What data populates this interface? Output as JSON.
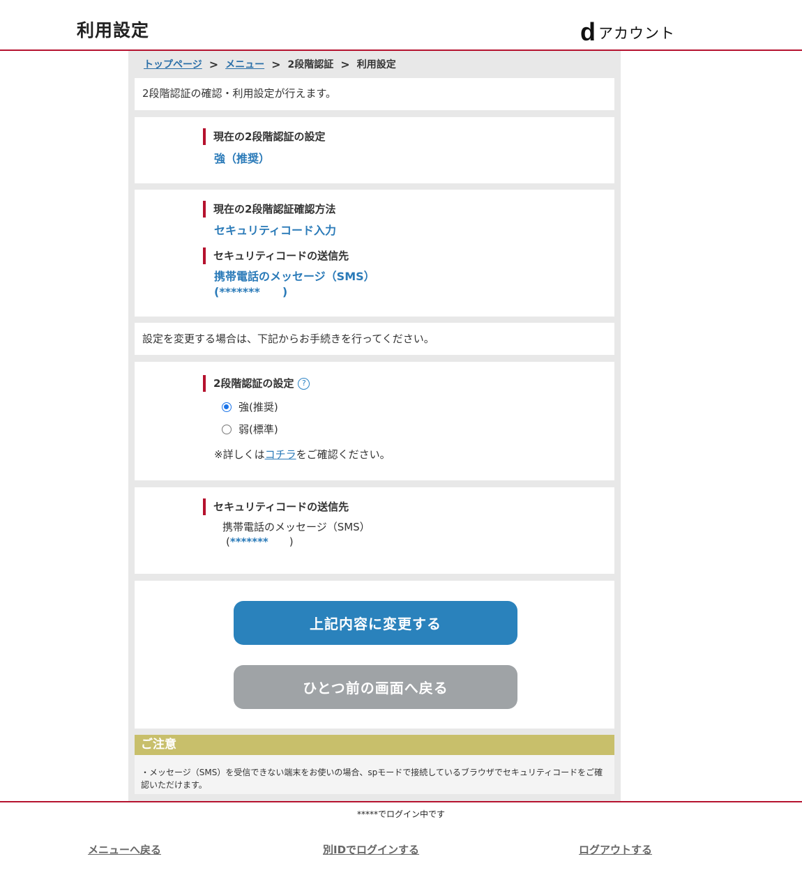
{
  "header": {
    "title": "利用設定",
    "logo_d": "d",
    "logo_text": "アカウント"
  },
  "breadcrumb": {
    "items": [
      "トップページ",
      "メニュー",
      "2段階認証",
      "利用設定"
    ],
    "separator": ">"
  },
  "intro": {
    "text": "2段階認証の確認・利用設定が行えます。"
  },
  "current_setting": {
    "heading": "現在の2段階認証の設定",
    "value": "強（推奨）"
  },
  "current_method": {
    "heading": "現在の2段階認証確認方法",
    "value": "セキュリティコード入力",
    "destination_heading": "セキュリティコードの送信先",
    "destination_value": "携帯電話のメッセージ（SMS）",
    "destination_number": "(*******　　)"
  },
  "change_intro": {
    "text": "設定を変更する場合は、下記からお手続きを行ってください。"
  },
  "setting_form": {
    "heading": "2段階認証の設定",
    "help_icon": "?",
    "options": [
      {
        "label": "強(推奨)",
        "checked": true
      },
      {
        "label": "弱(標準)",
        "checked": false
      }
    ],
    "note_prefix": "※詳しくは",
    "note_link": "コチラ",
    "note_suffix": "をご確認ください。"
  },
  "destination_form": {
    "heading": "セキュリティコードの送信先",
    "value": "携帯電話のメッセージ（SMS）",
    "number_open": "(",
    "number_stars": "*******",
    "number_close": "　　)"
  },
  "buttons": {
    "submit": "上記内容に変更する",
    "back": "ひとつ前の画面へ戻る"
  },
  "caution": {
    "heading": "ご注意",
    "text": "・メッセージ（SMS）を受信できない端末をお使いの場合、spモードで接続しているブラウザでセキュリティコードをご確認いただけます。"
  },
  "footer": {
    "login_status": "*****でログイン中です",
    "links": [
      "メニューへ戻る",
      "別IDでログインする",
      "ログアウトする"
    ]
  },
  "colors": {
    "accent_red": "#b5122e",
    "link_blue": "#2a7ab8",
    "button_blue": "#2a82bc",
    "button_gray": "#9fa3a6",
    "caution_gold": "#c8bf6b"
  }
}
